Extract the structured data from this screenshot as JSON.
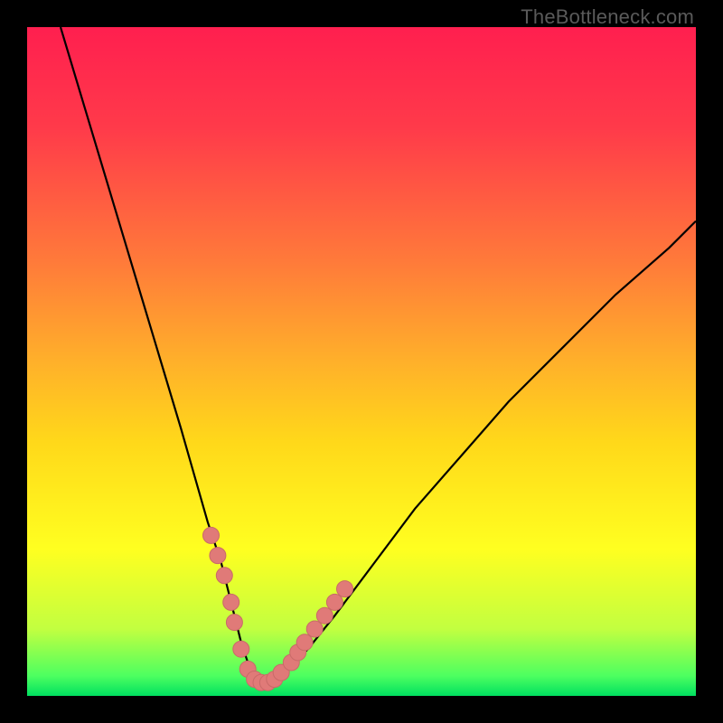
{
  "credit": "TheBottleneck.com",
  "colors": {
    "black": "#000000",
    "credit_text": "#5a5a5a",
    "gradient_stops": [
      {
        "offset": 0.0,
        "color": "#ff1f4f"
      },
      {
        "offset": 0.15,
        "color": "#ff3a4a"
      },
      {
        "offset": 0.35,
        "color": "#ff7a3a"
      },
      {
        "offset": 0.5,
        "color": "#ffb02a"
      },
      {
        "offset": 0.62,
        "color": "#ffd81a"
      },
      {
        "offset": 0.78,
        "color": "#ffff20"
      },
      {
        "offset": 0.9,
        "color": "#c2ff40"
      },
      {
        "offset": 0.97,
        "color": "#4dff60"
      },
      {
        "offset": 1.0,
        "color": "#00e060"
      }
    ],
    "curve": "#000000",
    "dot_fill": "#e07a78",
    "dot_stroke": "#c96a68"
  },
  "chart_data": {
    "type": "line",
    "title": "",
    "xlabel": "",
    "ylabel": "",
    "xlim": [
      0,
      100
    ],
    "ylim": [
      0,
      100
    ],
    "grid": false,
    "legend": false,
    "series": [
      {
        "name": "bottleneck-curve",
        "x": [
          5,
          8,
          11,
          14,
          17,
          20,
          23,
          25,
          27,
          29,
          30,
          31,
          32,
          33,
          34,
          35,
          36,
          37,
          39,
          42,
          46,
          52,
          58,
          65,
          72,
          80,
          88,
          96,
          100
        ],
        "y": [
          100,
          90,
          80,
          70,
          60,
          50,
          40,
          33,
          26,
          20,
          16,
          12,
          8,
          5,
          3,
          2,
          2,
          3,
          4,
          7,
          12,
          20,
          28,
          36,
          44,
          52,
          60,
          67,
          71
        ]
      }
    ],
    "markers": [
      {
        "name": "marker-points",
        "x": [
          27.5,
          28.5,
          29.5,
          30.5,
          31.0,
          32.0,
          33.0,
          34.0,
          35.0,
          36.0,
          37.0,
          38.0,
          39.5,
          40.5,
          41.5,
          43.0,
          44.5,
          46.0,
          47.5
        ],
        "y": [
          24,
          21,
          18,
          14,
          11,
          7,
          4,
          2.5,
          2,
          2,
          2.5,
          3.5,
          5,
          6.5,
          8,
          10,
          12,
          14,
          16
        ]
      }
    ],
    "annotations": []
  }
}
